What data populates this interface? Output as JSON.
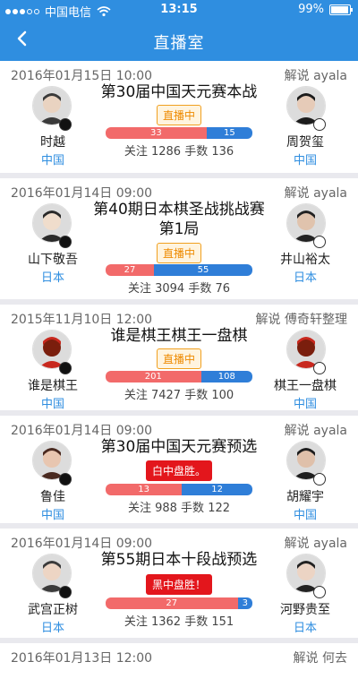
{
  "status": {
    "carrier": "中国电信",
    "time": "13:15",
    "battery": "99%"
  },
  "nav": {
    "title": "直播室"
  },
  "games": [
    {
      "date": "2016年01月15日  10:00",
      "commentary": "解说 ayala",
      "title": "第30届中国天元赛本战",
      "badge": "直播中",
      "badge_type": "live",
      "black": {
        "name": "时越",
        "country": "中国"
      },
      "white": {
        "name": "周贺玺",
        "country": "中国"
      },
      "black_count": 33,
      "white_count": 15,
      "stats": "关注 1286 手数 136"
    },
    {
      "date": "2016年01月14日  09:00",
      "commentary": "解说 ayala",
      "title": "第40期日本棋圣战挑战赛第1局",
      "badge": "直播中",
      "badge_type": "live",
      "black": {
        "name": "山下敬吾",
        "country": "日本"
      },
      "white": {
        "name": "井山裕太",
        "country": "日本"
      },
      "black_count": 27,
      "white_count": 55,
      "stats": "关注 3094 手数 76"
    },
    {
      "date": "2015年11月10日  12:00",
      "commentary": "解说 傅奇轩整理",
      "title": "谁是棋王棋王一盘棋",
      "badge": "直播中",
      "badge_type": "live",
      "black": {
        "name": "谁是棋王",
        "country": "中国"
      },
      "white": {
        "name": "棋王一盘棋",
        "country": "中国"
      },
      "black_count": 201,
      "white_count": 108,
      "stats": "关注 7427 手数 100"
    },
    {
      "date": "2016年01月14日  09:00",
      "commentary": "解说 ayala",
      "title": "第30届中国天元赛预选",
      "badge": "白中盘胜。",
      "badge_type": "result",
      "black": {
        "name": "鲁佳",
        "country": "中国"
      },
      "white": {
        "name": "胡耀宇",
        "country": "中国"
      },
      "black_count": 13,
      "white_count": 12,
      "stats": "关注 988 手数 122"
    },
    {
      "date": "2016年01月14日  09:00",
      "commentary": "解说 ayala",
      "title": "第55期日本十段战预选",
      "badge": "黑中盘胜！",
      "badge_type": "result",
      "black": {
        "name": "武宫正树",
        "country": "日本"
      },
      "white": {
        "name": "河野贵至",
        "country": "日本"
      },
      "black_count": 27,
      "white_count": 3,
      "stats": "关注 1362 手数 151"
    },
    {
      "date": "2016年01月13日  12:00",
      "commentary": "解说 何去",
      "title": "",
      "badge": "",
      "badge_type": "",
      "black": {
        "name": "",
        "country": ""
      },
      "white": {
        "name": "",
        "country": ""
      },
      "black_count": 0,
      "white_count": 0,
      "stats": ""
    }
  ]
}
